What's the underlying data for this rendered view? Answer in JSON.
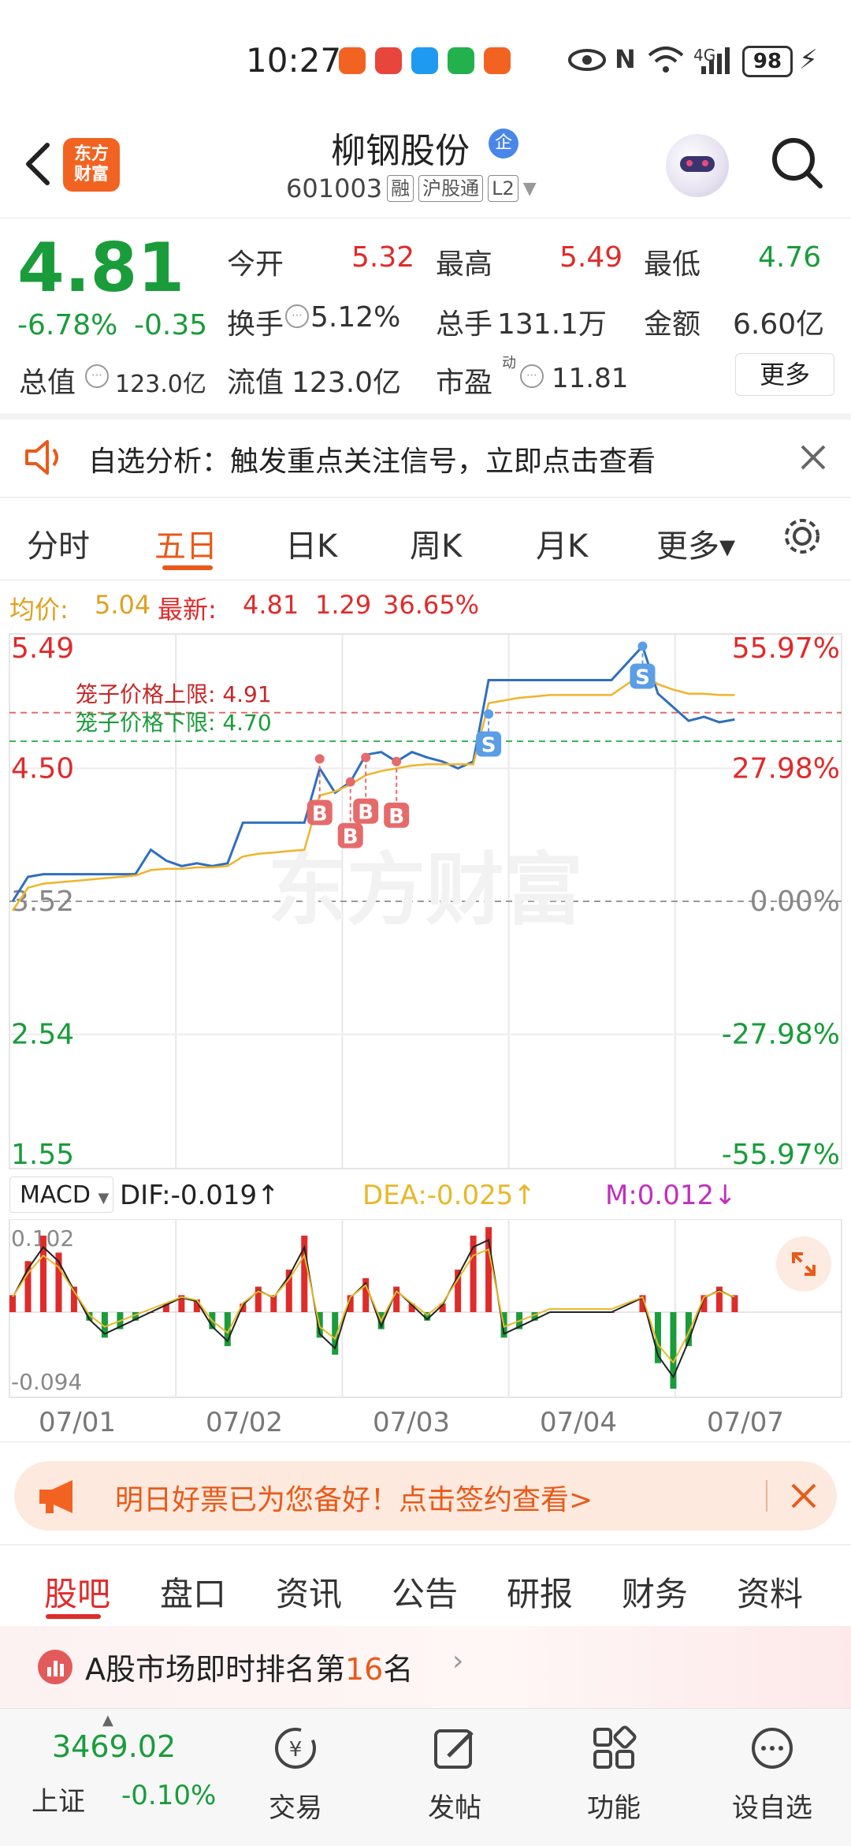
{
  "status": {
    "time": "10:27",
    "battery": "98",
    "network": "4G"
  },
  "header": {
    "logo_text_1": "东方",
    "logo_text_2": "财富",
    "title": "柳钢股份",
    "title_badge": "企",
    "code": "601003",
    "tags": [
      "融",
      "沪股通",
      "L2"
    ]
  },
  "quote": {
    "price": "4.81",
    "change_pct": "-6.78%",
    "change": "-0.35",
    "rows": [
      [
        {
          "label": "今开",
          "value": "5.32",
          "color": "red"
        },
        {
          "label": "最高",
          "value": "5.49",
          "color": "red"
        },
        {
          "label": "最低",
          "value": "4.76",
          "color": "grn"
        }
      ],
      [
        {
          "label": "换手",
          "value": "5.12%",
          "color": "dark"
        },
        {
          "label": "总手",
          "value": "131.1万",
          "color": "dark"
        },
        {
          "label": "金额",
          "value": "6.60亿",
          "color": "dark"
        }
      ]
    ],
    "total_value_label": "总值",
    "total_value": "123.0亿",
    "float_value_label": "流值",
    "float_value": "123.0亿",
    "pe_label": "市盈",
    "pe_sup": "动",
    "pe_value": "11.81",
    "more_button": "更多"
  },
  "notice": {
    "text": "自选分析：触发重点关注信号，立即点击查看"
  },
  "chart_tabs": [
    "分时",
    "五日",
    "日K",
    "周K",
    "月K",
    "更多▾"
  ],
  "chart_legend": {
    "avg_label": "均价:",
    "avg_value": "5.04",
    "latest_label": "最新:",
    "latest_value": "4.81",
    "val2": "1.29",
    "val3": "36.65%"
  },
  "chart_data": {
    "type": "line",
    "title": "",
    "x_labels": [
      "07/01",
      "07/02",
      "07/03",
      "07/04",
      "07/07"
    ],
    "y_left_ticks": [
      "5.49",
      "4.50",
      "3.52",
      "2.54",
      "1.55"
    ],
    "y_right_ticks": [
      "55.97%",
      "27.98%",
      "0.00%",
      "-27.98%",
      "-55.97%"
    ],
    "ylim": [
      1.55,
      5.49
    ],
    "ref_price": 3.52,
    "upper_limit_label": "笼子价格上限: 4.91",
    "upper_limit": 4.91,
    "lower_limit_label": "笼子价格下限: 4.70",
    "lower_limit": 4.7,
    "watermark": "东方财富",
    "series": [
      {
        "name": "price",
        "color": "#2f6fbf",
        "values": [
          3.52,
          3.7,
          3.72,
          3.72,
          3.72,
          3.72,
          3.72,
          3.72,
          3.72,
          3.9,
          3.82,
          3.78,
          3.8,
          3.78,
          3.8,
          4.1,
          4.1,
          4.1,
          4.1,
          4.1,
          4.5,
          4.32,
          4.4,
          4.6,
          4.62,
          4.55,
          4.62,
          4.58,
          4.55,
          4.5,
          4.55,
          5.15,
          5.15,
          5.15,
          5.15,
          5.15,
          5.15,
          5.15,
          5.15,
          5.15,
          5.4,
          5.05,
          4.95,
          4.85,
          4.88,
          4.84,
          4.86
        ]
      },
      {
        "name": "avg",
        "color": "#f0b429",
        "values": [
          3.45,
          3.62,
          3.65,
          3.66,
          3.67,
          3.68,
          3.69,
          3.7,
          3.71,
          3.75,
          3.76,
          3.76,
          3.77,
          3.77,
          3.78,
          3.85,
          3.87,
          3.88,
          3.89,
          3.9,
          4.3,
          4.33,
          4.38,
          4.45,
          4.48,
          4.5,
          4.52,
          4.53,
          4.53,
          4.53,
          4.53,
          4.98,
          5.0,
          5.02,
          5.03,
          5.04,
          5.04,
          5.04,
          5.04,
          5.04,
          5.2,
          5.12,
          5.08,
          5.05,
          5.05,
          5.04,
          5.04
        ]
      }
    ],
    "markers": [
      {
        "label": "B",
        "x_index": 20,
        "y": 4.57
      },
      {
        "label": "B",
        "x_index": 22,
        "y": 4.4
      },
      {
        "label": "B",
        "x_index": 23,
        "y": 4.58
      },
      {
        "label": "B",
        "x_index": 25,
        "y": 4.55
      },
      {
        "label": "S",
        "x_index": 31,
        "y": 4.9
      },
      {
        "label": "S",
        "x_index": 40,
        "y": 5.4
      }
    ]
  },
  "macd": {
    "dropdown": "MACD",
    "dif": "DIF:-0.019↑",
    "dea": "DEA:-0.025↑",
    "m": "M:0.012↓",
    "top": "0.102",
    "bottom": "-0.094",
    "bars": [
      0.02,
      0.06,
      0.09,
      0.07,
      0.03,
      -0.01,
      -0.03,
      -0.02,
      -0.01,
      0,
      0.01,
      0.02,
      0.015,
      -0.02,
      -0.04,
      0.01,
      0.03,
      0.02,
      0.05,
      0.09,
      -0.03,
      -0.05,
      0.02,
      0.04,
      -0.02,
      0.03,
      0.01,
      -0.01,
      0.01,
      0.05,
      0.09,
      0.1,
      -0.03,
      -0.02,
      -0.01,
      0,
      0,
      0,
      0,
      0,
      0.02,
      -0.06,
      -0.09,
      -0.04,
      0.02,
      0.03,
      0.02
    ]
  },
  "banner": {
    "text": "明日好票已为您备好！点击签约查看>"
  },
  "bottom_tabs": [
    "股吧",
    "盘口",
    "资讯",
    "公告",
    "研报",
    "财务",
    "资料"
  ],
  "rank": {
    "prefix": "A股市场即时排名第",
    "number": "16",
    "suffix": "名"
  },
  "bottom_nav": {
    "index_value": "3469.02",
    "index_name": "上证",
    "index_change": "-0.10%",
    "items": [
      {
        "label": "交易",
        "icon": "trade-icon"
      },
      {
        "label": "发帖",
        "icon": "post-icon"
      },
      {
        "label": "功能",
        "icon": "function-icon"
      },
      {
        "label": "设自选",
        "icon": "add-watchlist-icon"
      }
    ]
  },
  "colors": {
    "red": "#e02b2b",
    "green": "#1a9c3b",
    "accent": "#e85a1a",
    "blue": "#2f6fbf",
    "gold": "#f0b429"
  }
}
